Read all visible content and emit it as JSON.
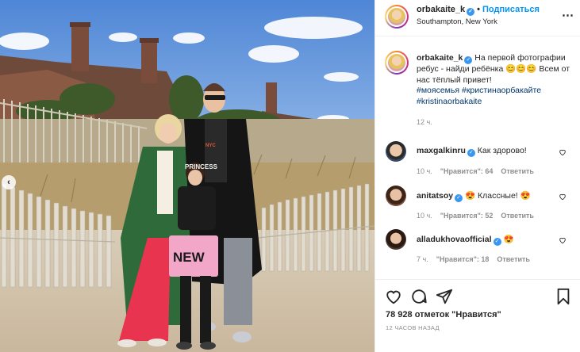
{
  "header": {
    "username": "orbakaite_k",
    "separator": "•",
    "follow_label": "Подписаться",
    "location": "Southampton, New York",
    "more_icon": "more-icon"
  },
  "caption": {
    "username": "orbakaite_k",
    "text": "На первой фотографии ребус - найди ребёнка 😊😊😊 Всем от нас тёплый привет!",
    "hashtags": [
      "#моясемья",
      "#кристинаорбакайте",
      "#kristinaorbakaite"
    ],
    "time": "12 ч."
  },
  "comments": [
    {
      "username": "maxgalkinru",
      "text": "Как здорово!",
      "time": "10 ч.",
      "likes": "\"Нравится\": 64",
      "reply": "Ответить"
    },
    {
      "username": "anitatsoy",
      "text": "😍 Классные! 😍",
      "time": "10 ч.",
      "likes": "\"Нравится\": 52",
      "reply": "Ответить"
    },
    {
      "username": "alladukhovaofficial",
      "text": "😍",
      "time": "7 ч.",
      "likes": "\"Нравится\": 18",
      "reply": "Ответить"
    }
  ],
  "actions": {
    "icons": [
      "heart-icon",
      "comment-icon",
      "share-icon",
      "bookmark-icon"
    ],
    "likes_count": "78 928",
    "likes_suffix": "отметок \"Нравится\"",
    "posted": "12 ЧАСОВ НАЗАД"
  },
  "photo": {
    "prev_label": "‹",
    "jacket_text": "NEW",
    "shirt_text": "PRINCESS"
  },
  "colors": {
    "link": "#0095f6",
    "hashtag": "#00376b",
    "verified": "#3897f0",
    "muted": "#8e8e8e"
  }
}
